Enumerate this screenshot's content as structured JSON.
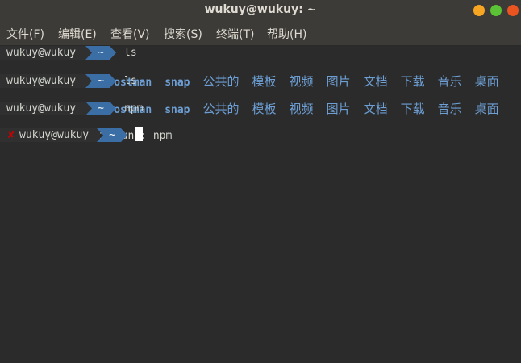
{
  "window": {
    "title": "wukuy@wukuy: ~",
    "buttons": [
      {
        "name": "minimize",
        "color": "#f6a623"
      },
      {
        "name": "maximize",
        "color": "#5bc236"
      },
      {
        "name": "close",
        "color": "#e95420"
      }
    ]
  },
  "menu": [
    "文件(F)",
    "编辑(E)",
    "查看(V)",
    "搜索(S)",
    "终端(T)",
    "帮助(H)"
  ],
  "terminal": {
    "prompts": [
      {
        "user": "wukuy@wukuy",
        "dir": "~",
        "command": "ls"
      },
      {
        "user": "wukuy@wukuy",
        "dir": "~",
        "command": "ls"
      },
      {
        "user": "wukuy@wukuy",
        "dir": "~",
        "command": "npm"
      },
      {
        "user": "wukuy@wukuy",
        "dir": "~",
        "command": "",
        "error_mark": "✘"
      }
    ],
    "ls_output": [
      "android_sdk",
      "Postman",
      "snap",
      "公共的",
      "模板",
      "视频",
      "图片",
      "文档",
      "下载",
      "音乐",
      "桌面"
    ],
    "error_line": "zsh: command not found: npm"
  }
}
